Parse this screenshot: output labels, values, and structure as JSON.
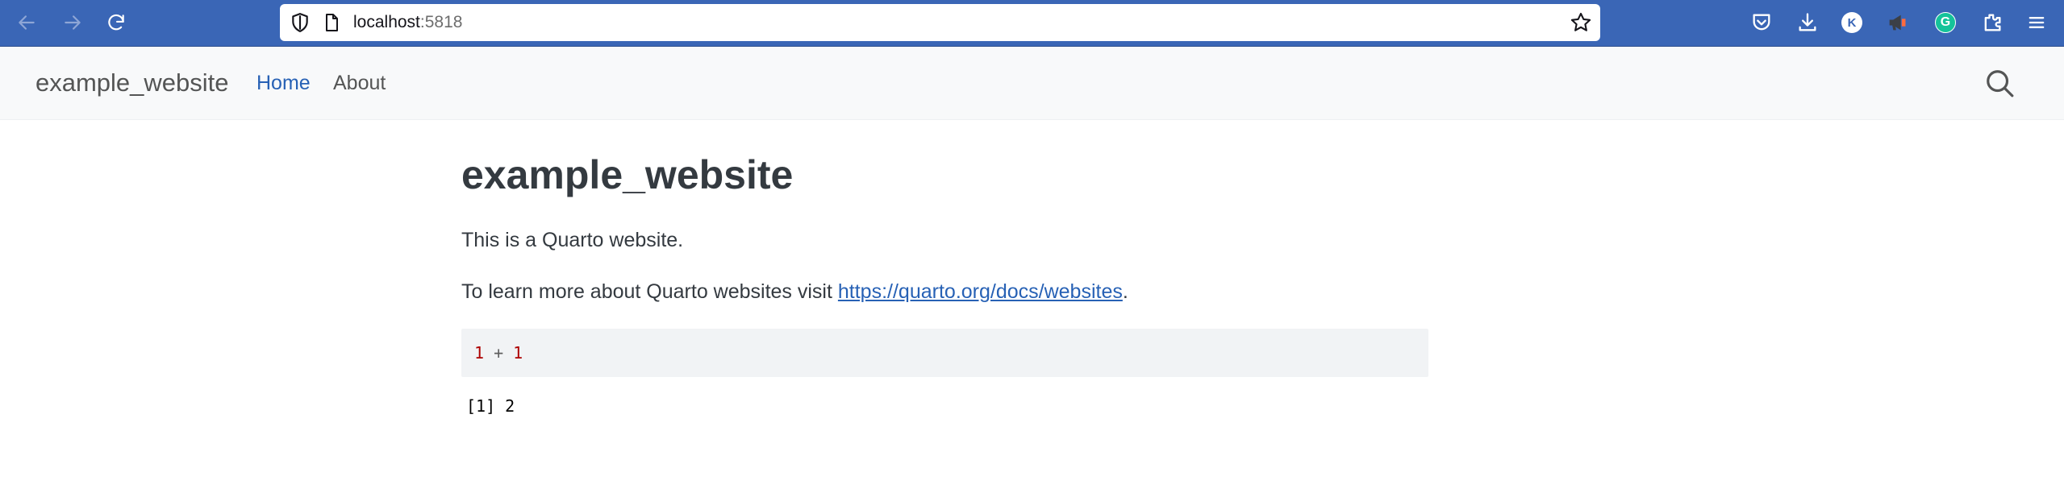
{
  "browser": {
    "url_host": "localhost",
    "url_port": ":5818",
    "icons": [
      "back-icon",
      "forward-icon",
      "reload-icon",
      "shield-icon",
      "page-icon",
      "star-icon",
      "pocket-icon",
      "download-icon",
      "account-avatar-icon",
      "extension-megaphone-icon",
      "grammarly-icon",
      "extensions-icon",
      "menu-icon"
    ],
    "account_initial": "K",
    "grammarly_letter": "G",
    "chrome_color": "#3a66b6"
  },
  "navbar": {
    "brand": "example_website",
    "links": [
      {
        "label": "Home",
        "active": true
      },
      {
        "label": "About",
        "active": false
      }
    ]
  },
  "main": {
    "title": "example_website",
    "paragraph1": "This is a Quarto website.",
    "paragraph2_prefix": "To learn more about Quarto websites visit ",
    "paragraph2_link": "https://quarto.org/docs/websites",
    "paragraph2_suffix": ".",
    "code": {
      "num1": "1",
      "operator": " + ",
      "num2": "1"
    },
    "output": "[1] 2"
  },
  "colors": {
    "link": "#2761b5",
    "code_number": "#ad0000",
    "code_background": "#f1f3f5",
    "navbar_background": "#f8f9fa"
  }
}
